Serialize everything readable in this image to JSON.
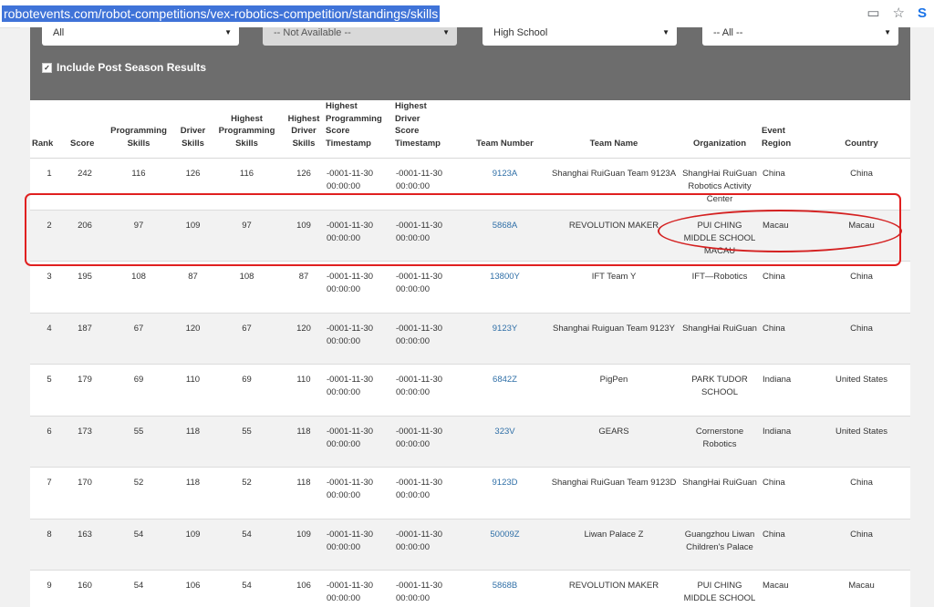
{
  "browser": {
    "url": "robotevents.com/robot-competitions/vex-robotics-competition/standings/skills",
    "icons": [
      "reader-mode-icon",
      "star-icon",
      "extension-icon"
    ]
  },
  "filters": {
    "select1": "All",
    "select2": "-- Not Available --",
    "select3": "High School",
    "select4": "-- All --",
    "postseason_label": "Include Post Season Results",
    "postseason_checked": true
  },
  "table": {
    "headers": [
      [
        "Rank"
      ],
      [
        "Score"
      ],
      [
        "Programming",
        "Skills"
      ],
      [
        "Driver",
        "Skills"
      ],
      [
        "Highest",
        "Programming",
        "Skills"
      ],
      [
        "Highest",
        "Driver",
        "Skills"
      ],
      [
        "Highest",
        "Programming",
        "Score",
        "Timestamp"
      ],
      [
        "Highest",
        "Driver",
        "Score",
        "Timestamp"
      ],
      [
        "Team Number"
      ],
      [
        "Team Name"
      ],
      [
        "Organization"
      ],
      [
        "Event",
        "Region"
      ],
      [
        "Country"
      ]
    ],
    "rows": [
      {
        "rank": "1",
        "score": "242",
        "prog": "116",
        "driver": "126",
        "hprog": "116",
        "hdriver": "126",
        "progts": "-0001-11-30 00:00:00",
        "drivts": "-0001-11-30 00:00:00",
        "team": "9123A",
        "name": "Shanghai RuiGuan Team 9123A",
        "org": "ShangHai RuiGuan Robotics Activity Center",
        "region": "China",
        "country": "China"
      },
      {
        "rank": "2",
        "score": "206",
        "prog": "97",
        "driver": "109",
        "hprog": "97",
        "hdriver": "109",
        "progts": "-0001-11-30 00:00:00",
        "drivts": "-0001-11-30 00:00:00",
        "team": "5868A",
        "name": "REVOLUTION MAKER",
        "org": "PUI CHING MIDDLE SCHOOL MACAU",
        "region": "Macau",
        "country": "Macau"
      },
      {
        "rank": "3",
        "score": "195",
        "prog": "108",
        "driver": "87",
        "hprog": "108",
        "hdriver": "87",
        "progts": "-0001-11-30 00:00:00",
        "drivts": "-0001-11-30 00:00:00",
        "team": "13800Y",
        "name": "IFT Team Y",
        "org": "IFT—Robotics",
        "region": "China",
        "country": "China"
      },
      {
        "rank": "4",
        "score": "187",
        "prog": "67",
        "driver": "120",
        "hprog": "67",
        "hdriver": "120",
        "progts": "-0001-11-30 00:00:00",
        "drivts": "-0001-11-30 00:00:00",
        "team": "9123Y",
        "name": "Shanghai Ruiguan Team 9123Y",
        "org": "ShangHai RuiGuan",
        "region": "China",
        "country": "China"
      },
      {
        "rank": "5",
        "score": "179",
        "prog": "69",
        "driver": "110",
        "hprog": "69",
        "hdriver": "110",
        "progts": "-0001-11-30 00:00:00",
        "drivts": "-0001-11-30 00:00:00",
        "team": "6842Z",
        "name": "PigPen",
        "org": "PARK TUDOR SCHOOL",
        "region": "Indiana",
        "country": "United States"
      },
      {
        "rank": "6",
        "score": "173",
        "prog": "55",
        "driver": "118",
        "hprog": "55",
        "hdriver": "118",
        "progts": "-0001-11-30 00:00:00",
        "drivts": "-0001-11-30 00:00:00",
        "team": "323V",
        "name": "GEARS",
        "org": "Cornerstone Robotics",
        "region": "Indiana",
        "country": "United States"
      },
      {
        "rank": "7",
        "score": "170",
        "prog": "52",
        "driver": "118",
        "hprog": "52",
        "hdriver": "118",
        "progts": "-0001-11-30 00:00:00",
        "drivts": "-0001-11-30 00:00:00",
        "team": "9123D",
        "name": "Shanghai RuiGuan Team 9123D",
        "org": "ShangHai RuiGuan",
        "region": "China",
        "country": "China"
      },
      {
        "rank": "8",
        "score": "163",
        "prog": "54",
        "driver": "109",
        "hprog": "54",
        "hdriver": "109",
        "progts": "-0001-11-30 00:00:00",
        "drivts": "-0001-11-30 00:00:00",
        "team": "50009Z",
        "name": "Liwan Palace Z",
        "org": "Guangzhou Liwan Children's Palace",
        "region": "China",
        "country": "China"
      },
      {
        "rank": "9",
        "score": "160",
        "prog": "54",
        "driver": "106",
        "hprog": "54",
        "hdriver": "106",
        "progts": "-0001-11-30 00:00:00",
        "drivts": "-0001-11-30 00:00:00",
        "team": "5868B",
        "name": "REVOLUTION MAKER",
        "org": "PUI CHING MIDDLE SCHOOL MACAU",
        "region": "Macau",
        "country": "Macau"
      }
    ]
  },
  "colors": {
    "annotation": "#e02020",
    "link": "#2f6fa7",
    "filter_bg": "#6d6d6d"
  }
}
